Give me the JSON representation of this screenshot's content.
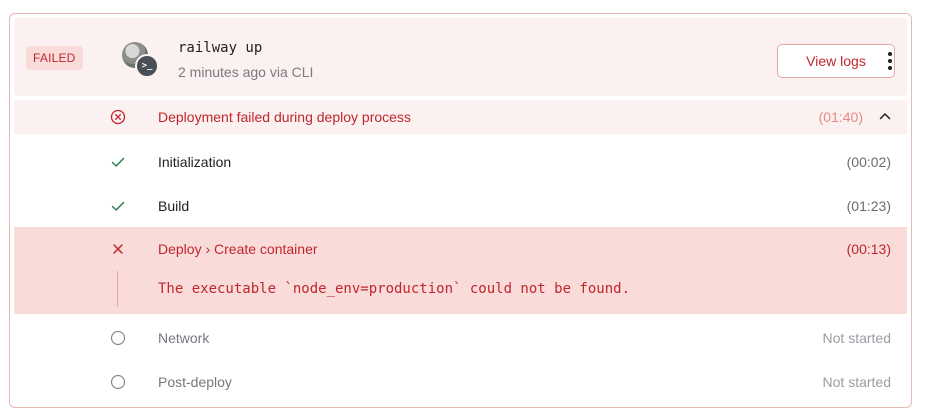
{
  "deployment": {
    "status_badge": "FAILED",
    "command": "railway up",
    "meta": "2 minutes ago via CLI",
    "view_logs_label": "View logs",
    "cli_icon": "terminal-icon",
    "menu_icon": "more-vertical-icon"
  },
  "summary": {
    "label": "Deployment failed during deploy process",
    "time": "(01:40)",
    "icon": "x-circle-icon",
    "toggle_icon": "chevron-up-icon"
  },
  "steps": [
    {
      "label": "Initialization",
      "time": "(00:02)",
      "status": "success",
      "icon": "check-icon"
    },
    {
      "label": "Build",
      "time": "(01:23)",
      "status": "success",
      "icon": "check-icon"
    },
    {
      "label": "Deploy › Create container",
      "time": "(00:13)",
      "status": "failed",
      "icon": "x-icon",
      "error": "The executable `node_env=production` could not be found."
    },
    {
      "label": "Network",
      "time": "Not started",
      "status": "pending",
      "icon": "circle-icon"
    },
    {
      "label": "Post-deploy",
      "time": "Not started",
      "status": "pending",
      "icon": "circle-icon"
    }
  ],
  "colors": {
    "error": "#c0262d",
    "error_bg": "#f9dcda",
    "header_bg": "#fbf1f0",
    "success": "#2f7d4f",
    "muted": "#9b9ba3"
  }
}
